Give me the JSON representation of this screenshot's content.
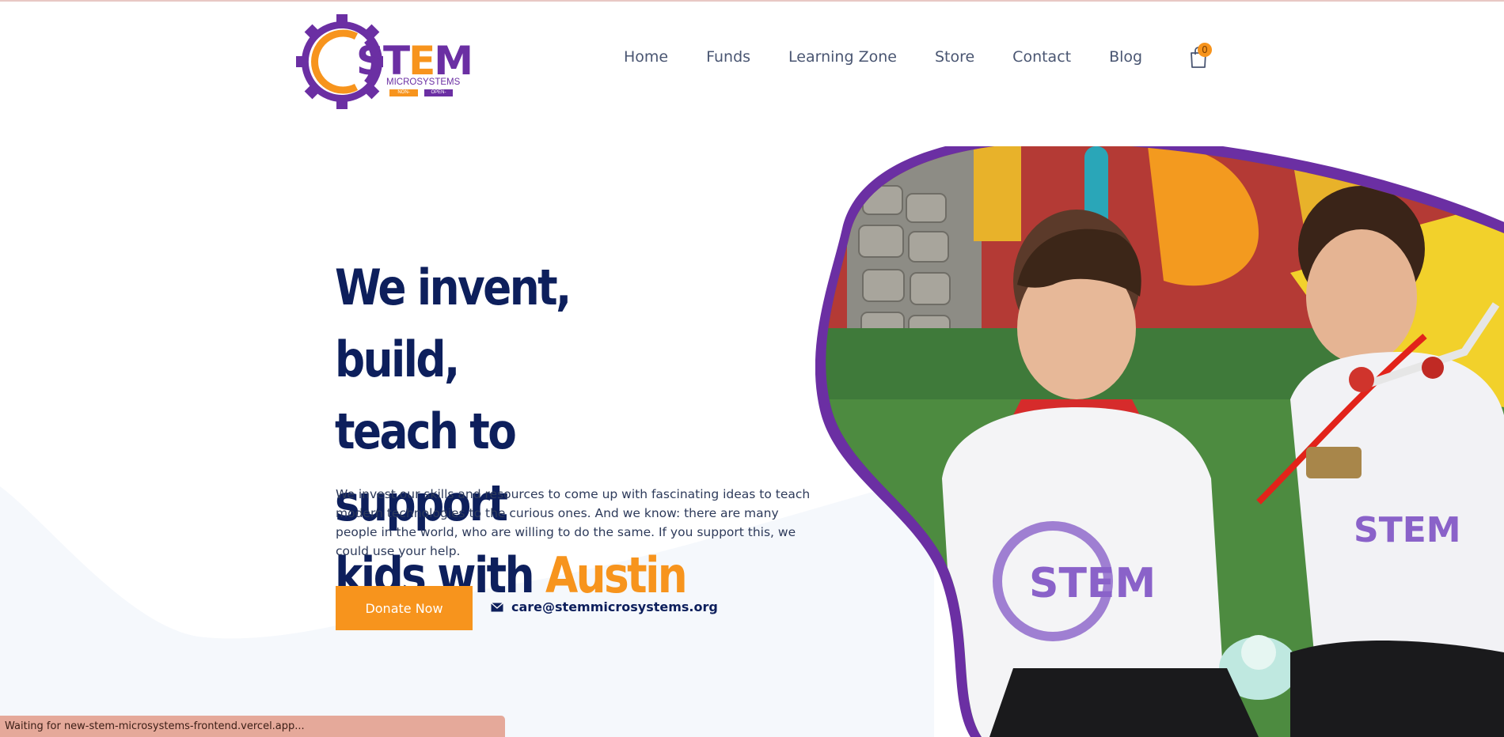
{
  "brand": {
    "name_part1": "ST",
    "name_part2": "E",
    "name_part3": "M",
    "subtitle": "MICROSYSTEMS",
    "tag_left": "NON-PROFIT",
    "tag_right": "OPEN-SOURCE",
    "colors": {
      "purple": "#6b2fa3",
      "orange": "#f7941d"
    }
  },
  "nav": {
    "items": [
      {
        "label": "Home"
      },
      {
        "label": "Funds"
      },
      {
        "label": "Learning Zone"
      },
      {
        "label": "Store"
      },
      {
        "label": "Contact"
      },
      {
        "label": "Blog"
      }
    ],
    "cart_icon": "shopping-bag-icon",
    "cart_count": "0"
  },
  "hero": {
    "title_line1": "We invent, build,",
    "title_line2": "teach to support",
    "title_line3_prefix": "kids with ",
    "title_line3_accent": "Austin",
    "description": "We invest our skills and resources to come up with fascinating ideas to teach modern technologies to the curious ones. And we know: there are many people in the world, who are willing to do the same. If you support this, we could use your help.",
    "donate_label": "Donate Now",
    "email_icon": "envelope-icon",
    "email": "care@stemmicrosystems.org",
    "colors": {
      "title": "#0d1f5c",
      "accent": "#f7941d",
      "blob_border": "#6b2fa3"
    }
  },
  "status_bar": {
    "text": "Waiting for new-stem-microsystems-frontend.vercel.app..."
  }
}
